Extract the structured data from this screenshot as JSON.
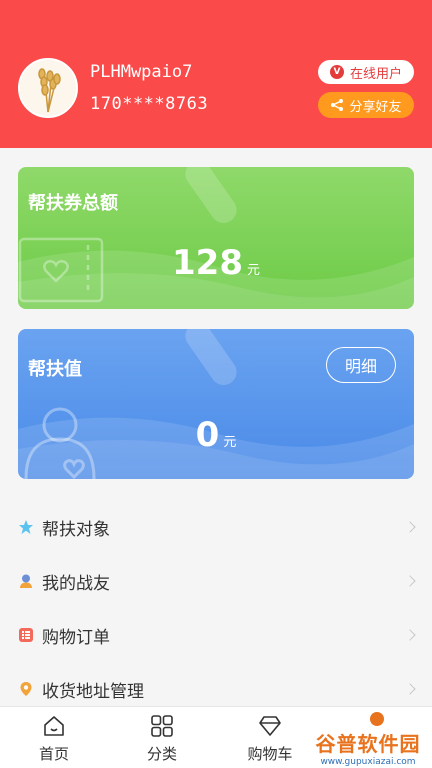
{
  "profile": {
    "username": "PLHMwpaio7",
    "phone": "170****8763",
    "online_label": "在线用户",
    "share_label": "分享好友"
  },
  "cards": {
    "voucher": {
      "title": "帮扶券总额",
      "amount": "128",
      "unit": "元"
    },
    "support": {
      "title": "帮扶值",
      "amount": "0",
      "unit": "元",
      "detail_label": "明细"
    }
  },
  "menu": [
    {
      "label": "帮扶对象",
      "icon": "star-icon"
    },
    {
      "label": "我的战友",
      "icon": "person-icon"
    },
    {
      "label": "购物订单",
      "icon": "order-list-icon"
    },
    {
      "label": "收货地址管理",
      "icon": "location-pin-icon"
    }
  ],
  "tabs": [
    {
      "label": "首页",
      "icon": "home-icon"
    },
    {
      "label": "分类",
      "icon": "grid-icon"
    },
    {
      "label": "购物车",
      "icon": "diamond-icon"
    },
    {
      "label": "",
      "icon": "profile-icon"
    }
  ],
  "watermark": {
    "text": "谷普软件园",
    "url": "www.gupuxiazai.com"
  },
  "colors": {
    "header": "#fb4a4a",
    "share_pill": "#ff9a1f",
    "card_green": "#6dcb46",
    "card_blue": "#4a8ae8"
  }
}
